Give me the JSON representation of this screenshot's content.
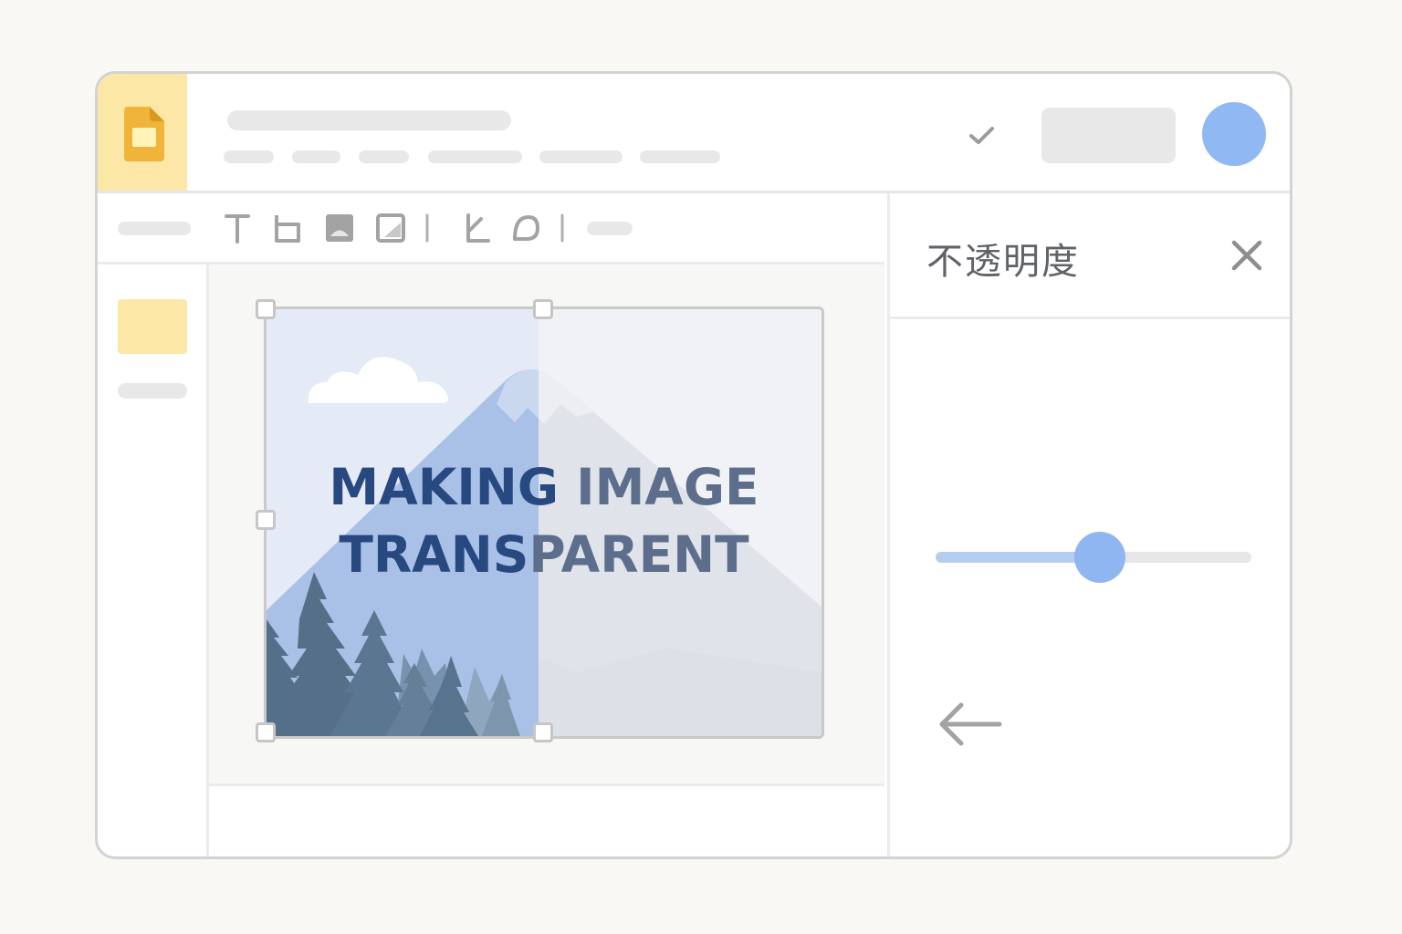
{
  "app": {
    "name_icon": "slides-icon",
    "accent": "#f2b63c",
    "header_bg": "#fde7a6"
  },
  "header": {
    "saved_icon": "check-icon",
    "avatar_color": "#90b8f2"
  },
  "toolbar": {
    "tools": [
      "text-tool-icon",
      "select-frame-icon",
      "image-icon",
      "crop-image-icon",
      "separator",
      "shape-icon",
      "mask-icon",
      "separator"
    ]
  },
  "slide": {
    "image_title": {
      "line1": {
        "left": "MAKING ",
        "right": "IMAGE"
      },
      "line2": {
        "left": "TRANS",
        "right": "PARENT"
      }
    }
  },
  "panel": {
    "title": "不透明度",
    "close_icon": "close-icon",
    "back_icon": "arrow-left-icon",
    "opacity_slider": {
      "value": 0.52,
      "fill_color": "#b6cdf0",
      "knob_color": "#8fb6f0"
    }
  }
}
